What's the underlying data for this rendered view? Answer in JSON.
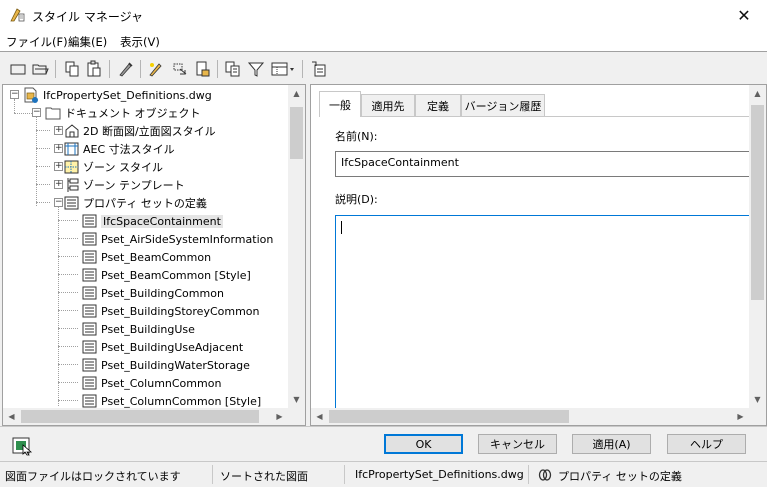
{
  "window": {
    "title": "スタイル マネージャ",
    "close_glyph": "✕"
  },
  "menu": [
    {
      "label": "ファイル(F)"
    },
    {
      "label": "編集(E)"
    },
    {
      "label": "表示(V)"
    }
  ],
  "toolbar": {
    "icons": [
      "new-file-icon",
      "open-folder-icon",
      "copy-icon",
      "paste-icon",
      "purge-icon",
      "edit-style-icon",
      "set-from-icon",
      "lock-icon",
      "toggle-view-icon",
      "filter-icon",
      "view-options-icon",
      "help-icon"
    ]
  },
  "tree": {
    "root": {
      "label": "IfcPropertySet_Definitions.dwg",
      "icon": "drawing-file-icon"
    },
    "document_objects": {
      "label": "ドキュメント オブジェクト",
      "icon": "folder-icon"
    },
    "groups": [
      {
        "label": "2D 断面図/立面図スタイル",
        "icon": "2d-section-icon"
      },
      {
        "label": "AEC 寸法スタイル",
        "icon": "dimension-style-icon"
      },
      {
        "label": "ゾーン スタイル",
        "icon": "zone-style-icon"
      },
      {
        "label": "ゾーン テンプレート",
        "icon": "zone-template-icon"
      },
      {
        "label": "プロパティ セットの定義",
        "icon": "property-set-icon"
      }
    ],
    "property_sets": [
      "IfcSpaceContainment",
      "Pset_AirSideSystemInformation",
      "Pset_BeamCommon",
      "Pset_BeamCommon [Style]",
      "Pset_BuildingCommon",
      "Pset_BuildingStoreyCommon",
      "Pset_BuildingUse",
      "Pset_BuildingUseAdjacent",
      "Pset_BuildingWaterStorage",
      "Pset_ColumnCommon",
      "Pset_ColumnCommon [Style]"
    ],
    "selected_index": 0
  },
  "tabs": [
    {
      "label": "一般"
    },
    {
      "label": "適用先"
    },
    {
      "label": "定義"
    },
    {
      "label": "バージョン履歴"
    }
  ],
  "form": {
    "name_label": "名前(N):",
    "name_value": "IfcSpaceContainment",
    "desc_label": "説明(D):",
    "desc_value": ""
  },
  "buttons": {
    "ok": "OK",
    "cancel": "キャンセル",
    "apply": "適用(A)",
    "help": "ヘルプ"
  },
  "status": {
    "lock": "図面ファイルはロックされています",
    "sort": "ソートされた図面",
    "file": "IfcPropertySet_Definitions.dwg",
    "category": "プロパティ セットの定義"
  }
}
